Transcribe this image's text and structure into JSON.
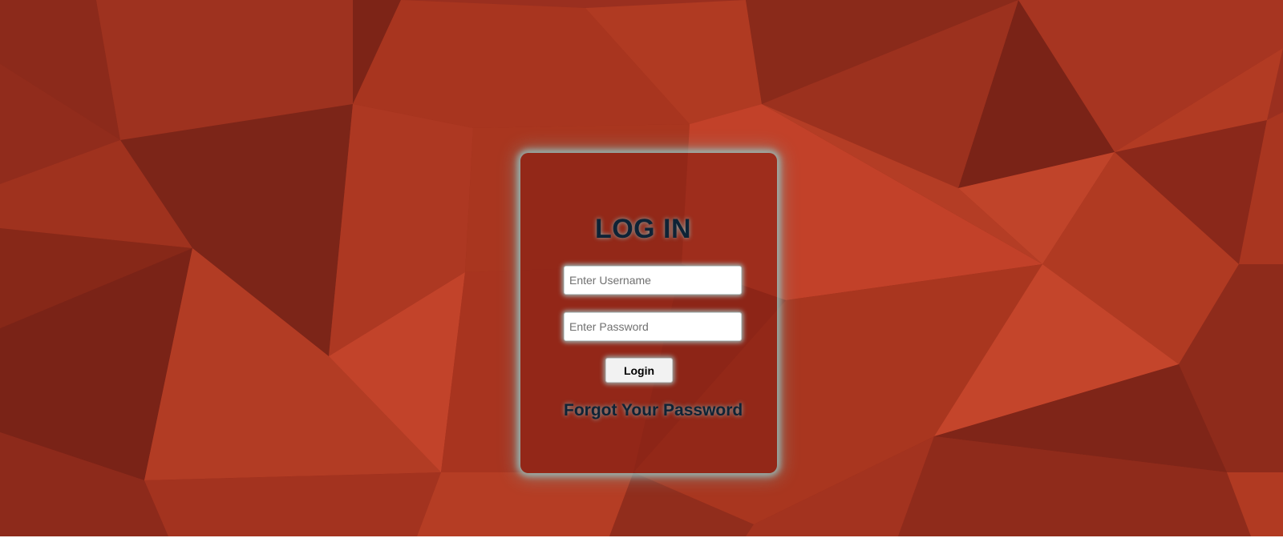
{
  "login_form": {
    "title": "LOG IN",
    "username": {
      "placeholder": "Enter Username",
      "value": ""
    },
    "password": {
      "placeholder": "Enter Password",
      "value": ""
    },
    "submit_label": "Login",
    "forgot_link": "Forgot Your Password"
  },
  "colors": {
    "background_red": "#b83a24",
    "title_text": "#0e2336",
    "glow": "#96cdcd"
  }
}
